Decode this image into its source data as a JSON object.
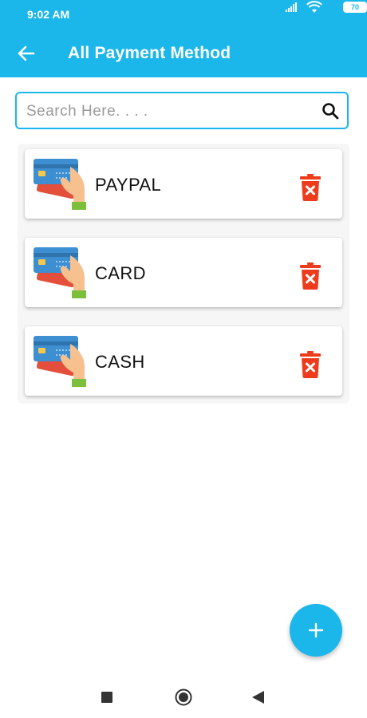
{
  "status_bar": {
    "time": "9:02 AM",
    "battery": "70"
  },
  "app_bar": {
    "title": "All Payment Method",
    "back_icon": "arrow-left-icon"
  },
  "search": {
    "placeholder": "Search Here. . . .",
    "value": "",
    "icon": "search-icon"
  },
  "payment_methods": [
    {
      "label": "PAYPAL",
      "icon": "credit-card-hand-icon",
      "action_icon": "delete-icon"
    },
    {
      "label": "CARD",
      "icon": "credit-card-hand-icon",
      "action_icon": "delete-icon"
    },
    {
      "label": "CASH",
      "icon": "credit-card-hand-icon",
      "action_icon": "delete-icon"
    }
  ],
  "fab": {
    "icon": "plus-icon"
  },
  "nav_bar": {
    "icons": [
      "recent-apps-icon",
      "home-icon",
      "back-icon"
    ]
  },
  "colors": {
    "primary": "#1bb6ea",
    "delete": "#ee3b1c",
    "list_bg": "#f6f6f6"
  }
}
